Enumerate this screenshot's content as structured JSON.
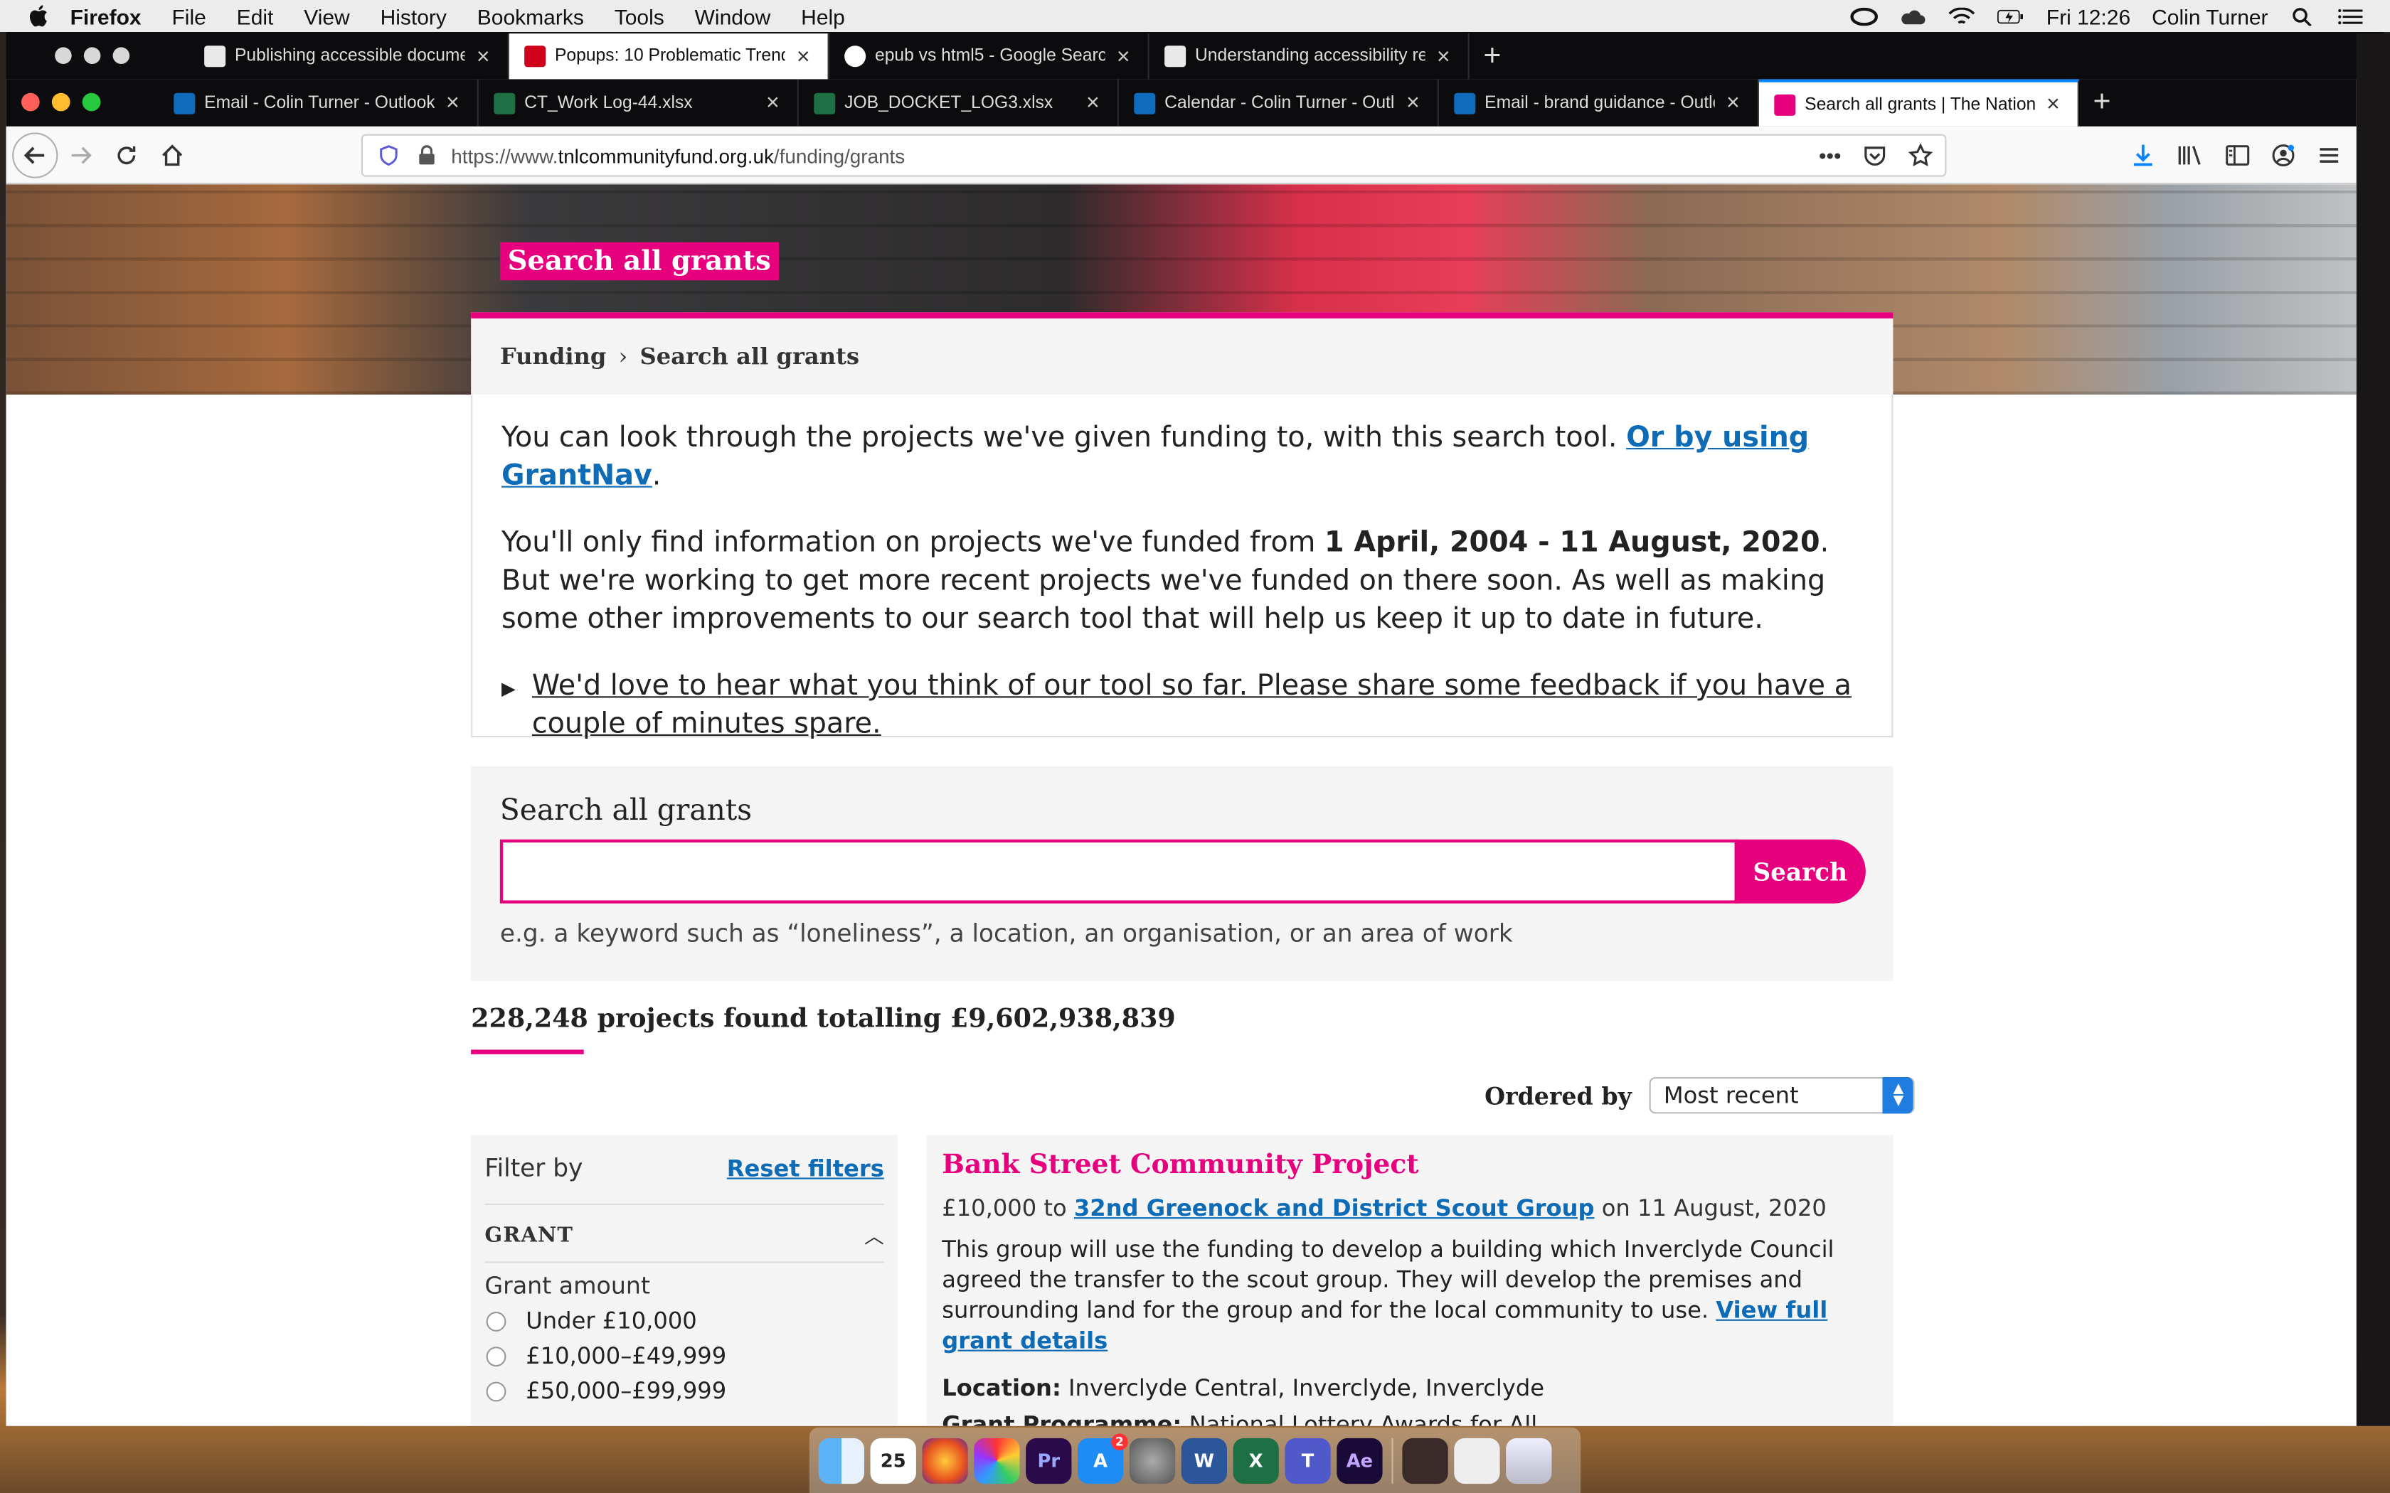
{
  "menubar": {
    "app": "Firefox",
    "items": [
      "File",
      "Edit",
      "View",
      "History",
      "Bookmarks",
      "Tools",
      "Window",
      "Help"
    ],
    "clock": "Fri 12:26",
    "user": "Colin Turner"
  },
  "back_window": {
    "tabs": [
      {
        "title": "Publishing accessible documen",
        "fav": "#e9e9e9"
      },
      {
        "title": "Popups: 10 Problematic Trends",
        "fav": "#d0021b"
      },
      {
        "title": "epub vs html5 - Google Search",
        "fav": "#4285f4"
      },
      {
        "title": "Understanding accessibility req",
        "fav": "#e9e9e9"
      }
    ]
  },
  "tabs": [
    {
      "title": "Email - Colin Turner - Outlook",
      "fav": "#0f6cbd"
    },
    {
      "title": "CT_Work Log-44.xlsx",
      "fav": "#1d7044"
    },
    {
      "title": "JOB_DOCKET_LOG3.xlsx",
      "fav": "#1d7044"
    },
    {
      "title": "Calendar - Colin Turner - Outlo",
      "fav": "#0f6cbd"
    },
    {
      "title": "Email - brand guidance - Outlo",
      "fav": "#0f6cbd"
    },
    {
      "title": "Search all grants | The National",
      "fav": "#e6007e"
    }
  ],
  "url": {
    "prefix": "https://www.",
    "domain": "tnlcommunityfund.org.uk",
    "path": "/funding/grants"
  },
  "hero": {
    "label": "Search all grants"
  },
  "breadcrumb": {
    "parent": "Funding",
    "sep": "›",
    "current": "Search all grants"
  },
  "intro": {
    "p1": "You can look through the projects we've given funding to, with this search tool. ",
    "p1_link": "Or by using GrantNav",
    "p1_end": ".",
    "p2_a": "You'll only find information on projects we've funded from ",
    "p2_bold": "1 April, 2004 - 11 August, 2020",
    "p2_b": ". But we're working to get more recent projects we've funded on there soon. As well as making some other improvements to our search tool that will help us keep it up to date in future.",
    "feedback": "We'd love to hear what you think of our tool so far. Please share some feedback if you have a couple of minutes spare."
  },
  "search": {
    "heading": "Search all grants",
    "button": "Search",
    "value": "",
    "hint": "e.g. a keyword such as “loneliness”, a location, an organisation, or an area of work"
  },
  "results": {
    "summary": "228,248 projects found totalling £9,602,938,839"
  },
  "order": {
    "label": "Ordered by",
    "selected": "Most recent"
  },
  "filter": {
    "title": "Filter by",
    "reset": "Reset filters",
    "section": "GRANT",
    "subsection": "Grant amount",
    "options": [
      "Under £10,000",
      "£10,000–£49,999",
      "£50,000–£99,999"
    ]
  },
  "grant": {
    "title": "Bank Street Community Project",
    "amount_prefix": "£10,000 to ",
    "recipient": "32nd Greenock and District Scout Group",
    "date": " on 11 August, 2020",
    "description": "This group will use the funding to develop a building which Inverclyde Council agreed the transfer to the scout group. They will develop the premises and surrounding land for the group and for the local community to use. ",
    "details_link": "View full grant details",
    "location_label": "Location:",
    "location": " Inverclyde Central, Inverclyde, Inverclyde",
    "programme_label": "Grant Programme:",
    "programme": " National Lottery Awards for All"
  },
  "dock": {
    "calendar_day": "25",
    "appstore_badge": "2"
  }
}
